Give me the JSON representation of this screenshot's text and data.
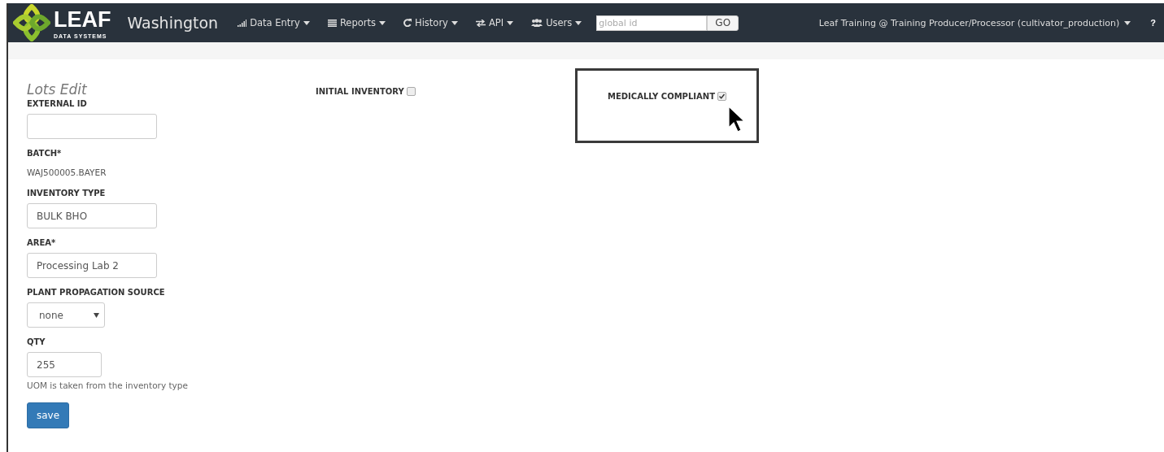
{
  "brand": {
    "name": "LEAF",
    "tagline": "DATA SYSTEMS",
    "state": "Washington"
  },
  "nav": {
    "menus": [
      {
        "label": "Data Entry"
      },
      {
        "label": "Reports"
      },
      {
        "label": "History"
      },
      {
        "label": "API"
      },
      {
        "label": "Users"
      }
    ],
    "search": {
      "placeholder": "global id",
      "button": "GO"
    },
    "user": "Leaf Training @ Training Producer/Processor (cultivator_production)",
    "help": "?"
  },
  "form": {
    "title": "Lots Edit",
    "fields": [
      {
        "kind": "text",
        "label": "EXTERNAL ID"
      },
      {
        "kind": "static",
        "label": "BATCH*",
        "value": "WAJ500005.BAYER"
      },
      {
        "kind": "text",
        "label": "INVENTORY TYPE",
        "value": "BULK BHO"
      },
      {
        "kind": "text",
        "label": "AREA*",
        "value": "Processing Lab 2"
      },
      {
        "kind": "select",
        "label": "PLANT PROPAGATION SOURCE",
        "value": "none"
      },
      {
        "kind": "short",
        "label": "QTY",
        "value": "255",
        "hint": "UOM is taken from the inventory type"
      }
    ],
    "save": "save",
    "checkboxes": [
      {
        "label": "INITIAL INVENTORY",
        "checked": false,
        "highlighted": false
      },
      {
        "label": "MEDICALLY COMPLIANT",
        "checked": true,
        "highlighted": true
      }
    ]
  }
}
